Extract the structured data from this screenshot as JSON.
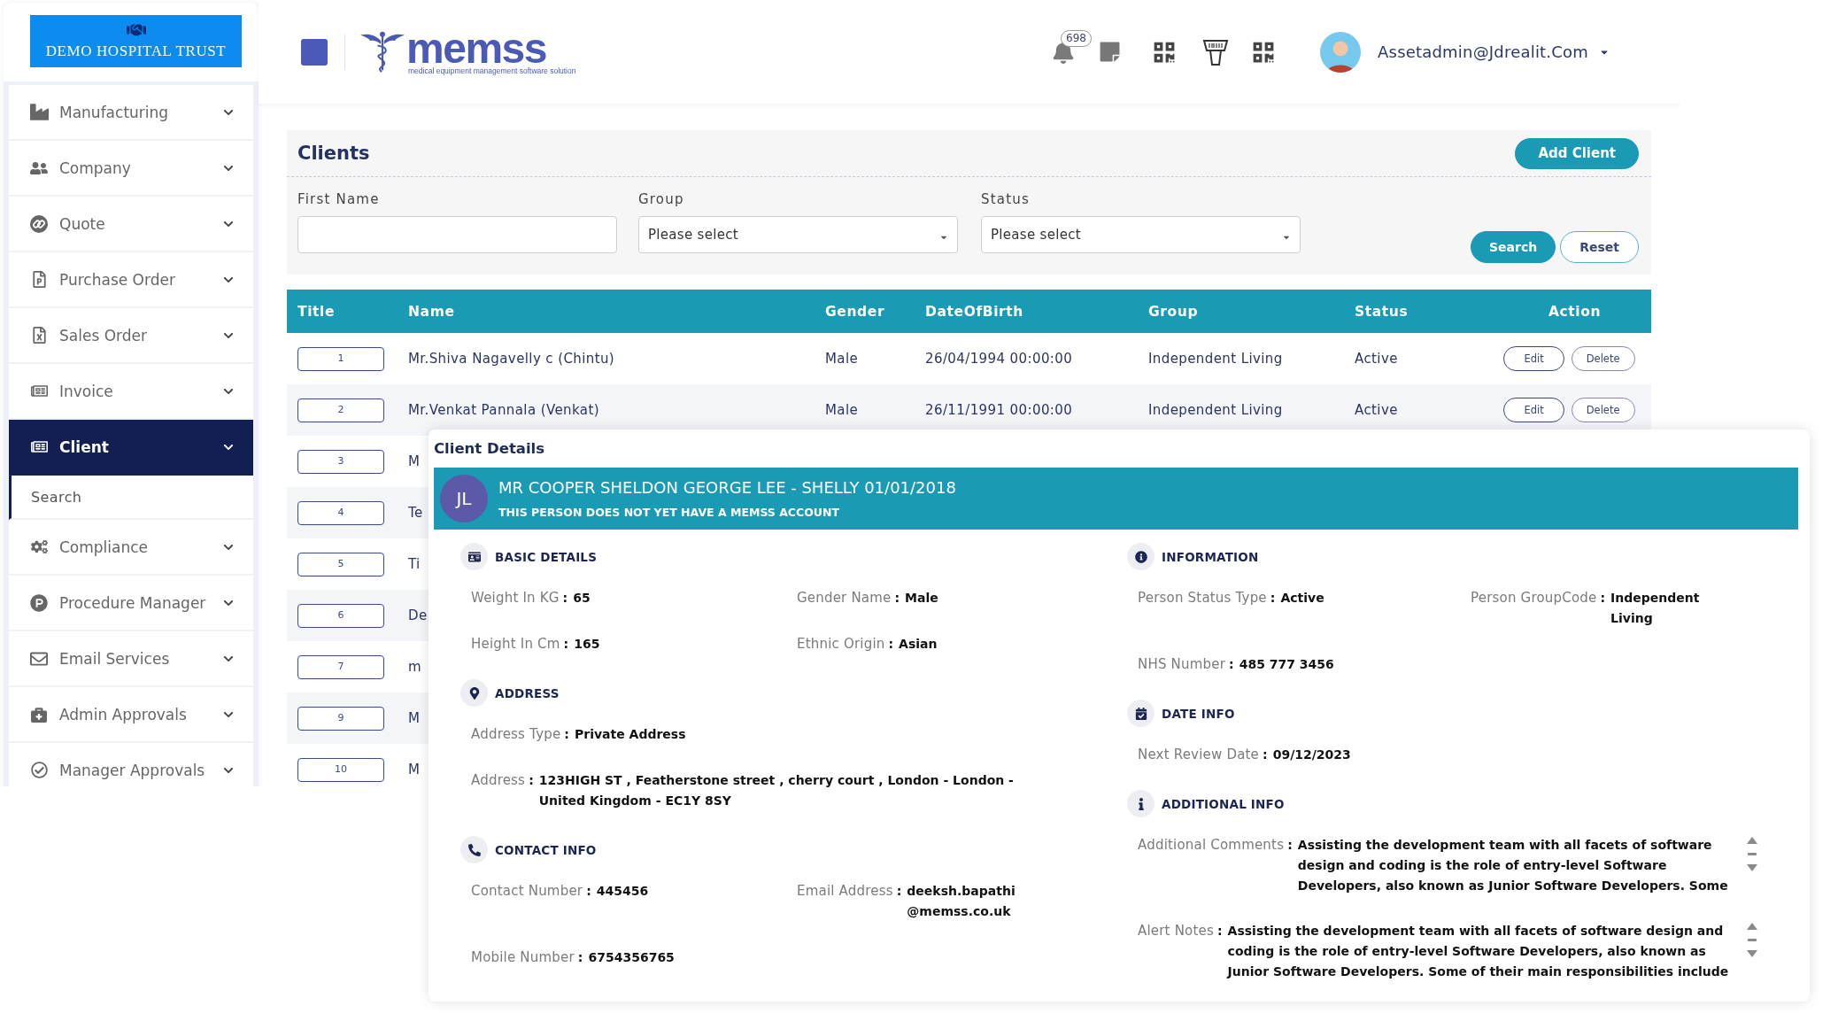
{
  "sidebar": {
    "logo_text": "DEMO HOSPITAL TRUST",
    "items": [
      {
        "label": "Manufacturing",
        "selected": false
      },
      {
        "label": "Company",
        "selected": false
      },
      {
        "label": "Quote",
        "selected": false
      },
      {
        "label": "Purchase Order",
        "selected": false
      },
      {
        "label": "Sales Order",
        "selected": false
      },
      {
        "label": "Invoice",
        "selected": false
      },
      {
        "label": "Client",
        "selected": true,
        "children": [
          {
            "label": "Search",
            "selected": true
          }
        ]
      },
      {
        "label": "Compliance",
        "selected": false
      },
      {
        "label": "Procedure Manager",
        "selected": false
      },
      {
        "label": "Email Services",
        "selected": false
      },
      {
        "label": "Admin Approvals",
        "selected": false
      },
      {
        "label": "Manager Approvals",
        "selected": false
      }
    ]
  },
  "header": {
    "brand_name": "memss",
    "brand_tagline": "medical equipment management software solution",
    "notification_count": "698",
    "user_email": "Assetadmin@Jdrealit.Com"
  },
  "clients": {
    "title": "Clients",
    "add_button": "Add Client",
    "filters": [
      {
        "label": "First Name",
        "kind": "text"
      },
      {
        "label": "Group",
        "kind": "select",
        "placeholder": "Please select"
      },
      {
        "label": "Status",
        "kind": "select",
        "placeholder": "Please select"
      }
    ],
    "buttons": [
      {
        "label": "Search",
        "kind": "primary"
      },
      {
        "label": "Reset",
        "kind": "secondary"
      }
    ]
  },
  "table": {
    "columns": [
      "Title",
      "Name",
      "Gender",
      "DateOfBirth",
      "Group",
      "Status",
      "Action"
    ],
    "rows": [
      {
        "title": "1",
        "name": "Mr.Shiva Nagavelly c (Chintu)",
        "gender": "Male",
        "date_of_birth": "26/04/1994 00:00:00",
        "group": "Independent Living",
        "status": "Active",
        "actions": [
          {
            "label": "Edit",
            "kind": "edit"
          },
          {
            "label": "Delete",
            "kind": "delete"
          }
        ]
      },
      {
        "title": "2",
        "name": "Mr.Venkat Pannala (Venkat)",
        "gender": "Male",
        "date_of_birth": "26/11/1991 00:00:00",
        "group": "Independent Living",
        "status": "Active",
        "actions": [
          {
            "label": "Edit",
            "kind": "edit"
          },
          {
            "label": "Delete",
            "kind": "delete"
          }
        ]
      },
      {
        "title": "3",
        "name": "M"
      },
      {
        "title": "4",
        "name": "Te"
      },
      {
        "title": "5",
        "name": "Ti"
      },
      {
        "title": "6",
        "name": "De"
      },
      {
        "title": "7",
        "name": "m"
      },
      {
        "title": "9",
        "name": "M"
      },
      {
        "title": "10",
        "name": "M"
      }
    ]
  },
  "client_details": {
    "title": "Client Details",
    "initials": "JL",
    "name": "MR COOPER SHELDON GEORGE LEE - SHELLY 01/01/2018",
    "account_note": "THIS PERSON DOES NOT YET HAVE A MEMSS ACCOUNT",
    "columns": [
      {
        "sections": [
          {
            "heading": "BASIC DETAILS",
            "kind": "fields",
            "rows": [
              [
                {
                  "label": "Weight In KG",
                  "sep": ":",
                  "value": "65"
                },
                {
                  "label": "Gender Name",
                  "sep": ":",
                  "value": "Male"
                }
              ],
              [
                {
                  "label": "Height In Cm",
                  "sep": ":",
                  "value": "165"
                },
                {
                  "label": "Ethnic Origin",
                  "sep": ":",
                  "value": "Asian"
                }
              ]
            ]
          },
          {
            "heading": "ADDRESS",
            "kind": "fields",
            "rows": [
              [
                {
                  "label": "Address Type",
                  "sep": ":",
                  "value": "Private Address"
                }
              ],
              [
                {
                  "label": "Address",
                  "sep": ":",
                  "value": "123HIGH ST , Featherstone street , cherry court , London - London - United Kingdom - EC1Y 8SY"
                }
              ]
            ]
          },
          {
            "heading": "CONTACT INFO",
            "kind": "fields",
            "rows": [
              [
                {
                  "label": "Contact Number",
                  "sep": ":",
                  "value": "445456"
                },
                {
                  "label": "Email Address",
                  "sep": ":",
                  "value": "deeksh.bapathi@memss.co.uk"
                }
              ],
              [
                {
                  "label": "Mobile Number",
                  "sep": ":",
                  "value": "6754356765"
                }
              ]
            ]
          }
        ]
      },
      {
        "sections": [
          {
            "heading": "INFORMATION",
            "kind": "fields",
            "rows": [
              [
                {
                  "label": "Person Status Type",
                  "sep": ":",
                  "value": "Active"
                },
                {
                  "label": "Person GroupCode",
                  "sep": ":",
                  "value": "Independent Living"
                }
              ],
              [
                {
                  "label": "NHS Number",
                  "sep": ":",
                  "value": "485 777 3456"
                }
              ]
            ]
          },
          {
            "heading": "DATE INFO",
            "kind": "fields",
            "rows": [
              [
                {
                  "label": "Next Review Date",
                  "sep": ":",
                  "value": "09/12/2023"
                }
              ]
            ]
          },
          {
            "heading": "ADDITIONAL INFO",
            "kind": "notes",
            "rows": [
              [
                {
                  "label": "Additional Comments",
                  "sep": ":",
                  "value": "Assisting the development team with all facets of software design and coding is the role of entry-level Software Developers, also known as Junior Software Developers. Some"
                }
              ],
              [
                {
                  "label": "Alert Notes",
                  "sep": ":",
                  "value": "Assisting the development team with all facets of software design and coding is the role of entry-level Software Developers, also known as Junior Software Developers. Some of their main responsibilities include"
                }
              ]
            ]
          }
        ]
      }
    ]
  }
}
